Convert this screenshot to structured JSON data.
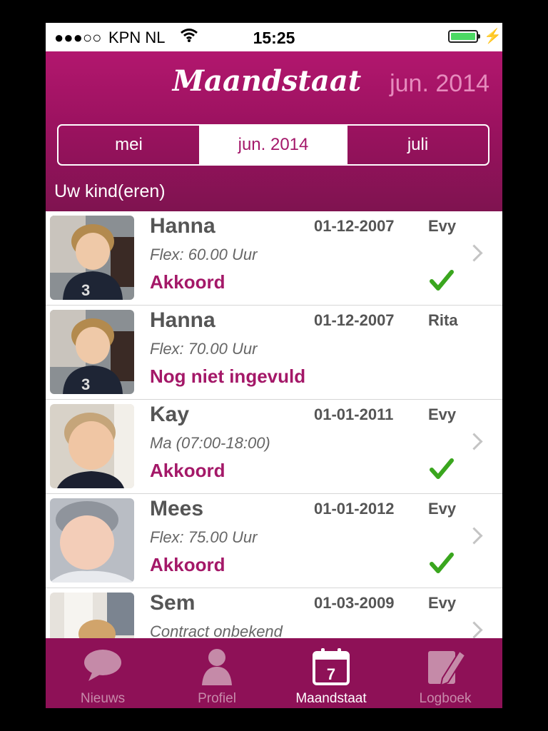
{
  "status_bar": {
    "signal": "●●●○○",
    "carrier": "KPN NL",
    "time": "15:25"
  },
  "header": {
    "title": "Maandstaat",
    "current_period": "jun. 2014",
    "segments": [
      "mei",
      "jun. 2014",
      "juli"
    ],
    "selected_segment": "jun. 2014",
    "section_title": "Uw kind(eren)"
  },
  "children": [
    {
      "name": "Hanna",
      "birthdate": "01-12-2007",
      "caretaker": "Evy",
      "detail": "Flex: 60.00 Uur",
      "status": "Akkoord",
      "checked": true,
      "photo_icon": "toddler-photo"
    },
    {
      "name": "Hanna",
      "birthdate": "01-12-2007",
      "caretaker": "Rita",
      "detail": "Flex: 70.00 Uur",
      "status": "Nog niet ingevuld",
      "checked": false,
      "photo_icon": "toddler-photo"
    },
    {
      "name": "Kay",
      "birthdate": "01-01-2011",
      "caretaker": "Evy",
      "detail": "Ma (07:00-18:00)",
      "status": "Akkoord",
      "checked": true,
      "photo_icon": "child-photo"
    },
    {
      "name": "Mees",
      "birthdate": "01-01-2012",
      "caretaker": "Evy",
      "detail": "Flex: 75.00 Uur",
      "status": "Akkoord",
      "checked": true,
      "photo_icon": "baby-photo"
    },
    {
      "name": "Sem",
      "birthdate": "01-03-2009",
      "caretaker": "Evy",
      "detail": "Contract onbekend",
      "status": "",
      "checked": false,
      "photo_icon": "child-photo"
    }
  ],
  "tabbar": {
    "tabs": [
      {
        "label": "Nieuws",
        "icon": "speech-bubble-icon"
      },
      {
        "label": "Profiel",
        "icon": "person-icon"
      },
      {
        "label": "Maandstaat",
        "icon": "calendar-icon",
        "calendar_day": "7"
      },
      {
        "label": "Logboek",
        "icon": "notebook-pencil-icon"
      }
    ],
    "active": "Maandstaat"
  },
  "colors": {
    "brand": "#9c1260",
    "accent_text": "#a41868",
    "check": "#3aa61e",
    "tabbar": "#8e1157"
  }
}
